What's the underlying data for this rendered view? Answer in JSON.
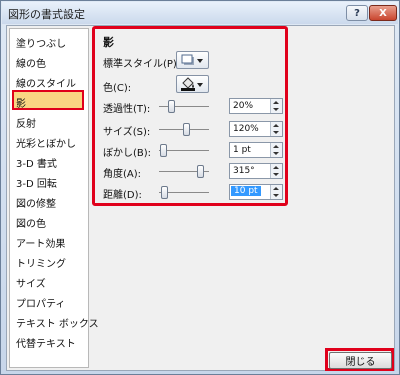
{
  "window": {
    "title": "図形の書式設定",
    "help_label": "?",
    "close_label": "X"
  },
  "sidebar": {
    "items": [
      {
        "label": "塗りつぶし"
      },
      {
        "label": "線の色"
      },
      {
        "label": "線のスタイル"
      },
      {
        "label": "影",
        "selected": true
      },
      {
        "label": "反射"
      },
      {
        "label": "光彩とぼかし"
      },
      {
        "label": "3-D 書式"
      },
      {
        "label": "3-D 回転"
      },
      {
        "label": "図の修整"
      },
      {
        "label": "図の色"
      },
      {
        "label": "アート効果"
      },
      {
        "label": "トリミング"
      },
      {
        "label": "サイズ"
      },
      {
        "label": "プロパティ"
      },
      {
        "label": "テキスト ボックス"
      },
      {
        "label": "代替テキスト"
      }
    ]
  },
  "shadow": {
    "section_title": "影",
    "preset_label": "標準スタイル(P):",
    "color_label": "色(C):",
    "properties": [
      {
        "label": "透過性(T):",
        "value": "20%",
        "level": 0.2
      },
      {
        "label": "サイズ(S):",
        "value": "120%",
        "level": 0.55
      },
      {
        "label": "ぼかし(B):",
        "value": "1 pt",
        "level": 0.02
      },
      {
        "label": "角度(A):",
        "value": "315°",
        "level": 0.875
      },
      {
        "label": "距離(D):",
        "value": "10 pt",
        "level": 0.05
      }
    ]
  },
  "footer": {
    "close_button_label": "閉じる"
  },
  "colors": {
    "highlight_outline": "#e0001b",
    "selected_item_bg": "#fad683"
  }
}
